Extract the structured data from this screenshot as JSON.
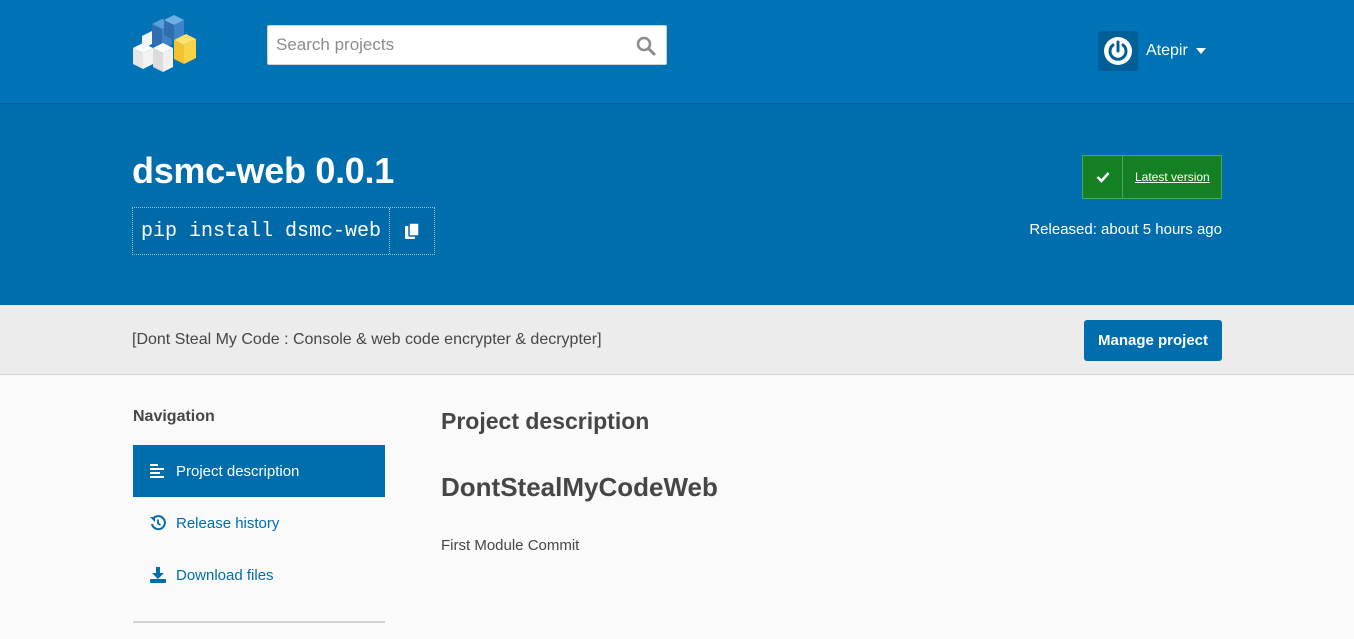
{
  "header": {
    "search_placeholder": "Search projects",
    "user_name": "Atepir"
  },
  "package": {
    "title": "dsmc-web 0.0.1",
    "pip_command": "pip install dsmc-web",
    "latest_label": "Latest version",
    "released": "Released: about 5 hours ago",
    "summary": "[Dont Steal My Code : Console & web code encrypter & decrypter]",
    "manage_label": "Manage project"
  },
  "navigation": {
    "title": "Navigation",
    "items": [
      {
        "label": "Project description",
        "icon": "align-left-icon",
        "active": true
      },
      {
        "label": "Release history",
        "icon": "history-icon",
        "active": false
      },
      {
        "label": "Download files",
        "icon": "download-icon",
        "active": false
      }
    ]
  },
  "content": {
    "section_heading": "Project description",
    "readme_heading": "DontStealMyCodeWeb",
    "readme_text": "First Module Commit"
  },
  "colors": {
    "header_blue": "#0073b7",
    "banner_blue": "#006dad",
    "latest_green": "#148024",
    "strip_gray": "#ececec"
  }
}
